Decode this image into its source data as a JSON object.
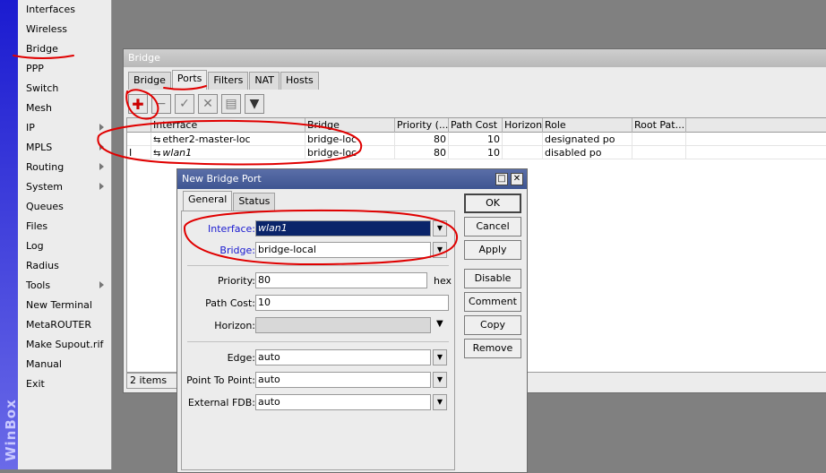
{
  "app": {
    "brand": "WinBox"
  },
  "menu": {
    "items": [
      {
        "label": "Interfaces",
        "submenu": false
      },
      {
        "label": "Wireless",
        "submenu": false
      },
      {
        "label": "Bridge",
        "submenu": false
      },
      {
        "label": "PPP",
        "submenu": false
      },
      {
        "label": "Switch",
        "submenu": false
      },
      {
        "label": "Mesh",
        "submenu": false
      },
      {
        "label": "IP",
        "submenu": true
      },
      {
        "label": "MPLS",
        "submenu": true
      },
      {
        "label": "Routing",
        "submenu": true
      },
      {
        "label": "System",
        "submenu": true
      },
      {
        "label": "Queues",
        "submenu": false
      },
      {
        "label": "Files",
        "submenu": false
      },
      {
        "label": "Log",
        "submenu": false
      },
      {
        "label": "Radius",
        "submenu": false
      },
      {
        "label": "Tools",
        "submenu": true
      },
      {
        "label": "New Terminal",
        "submenu": false
      },
      {
        "label": "MetaROUTER",
        "submenu": false
      },
      {
        "label": "Make Supout.rif",
        "submenu": false
      },
      {
        "label": "Manual",
        "submenu": false
      },
      {
        "label": "Exit",
        "submenu": false
      }
    ]
  },
  "bridge_window": {
    "title": "Bridge",
    "tabs": [
      "Bridge",
      "Ports",
      "Filters",
      "NAT",
      "Hosts"
    ],
    "active_tab": "Ports",
    "toolbar_icons": [
      "add-icon",
      "remove-icon",
      "enable-icon",
      "disable-icon",
      "comment-icon",
      "filter-icon"
    ],
    "columns": [
      "",
      "Interface",
      "Bridge",
      "Priority (...",
      "Path Cost",
      "Horizon",
      "Role",
      "Root Pat..."
    ],
    "rows": [
      {
        "flag": "",
        "interface": "ether2-master-loc",
        "bridge": "bridge-loc",
        "priority": "80",
        "path_cost": "10",
        "horizon": "",
        "role": "designated po",
        "root_path": ""
      },
      {
        "flag": "I",
        "interface": "wlan1",
        "bridge": "bridge-loc",
        "priority": "80",
        "path_cost": "10",
        "horizon": "",
        "role": "disabled po",
        "root_path": ""
      }
    ],
    "status": "2 items"
  },
  "dialog": {
    "title": "New Bridge Port",
    "tabs": [
      "General",
      "Status"
    ],
    "active_tab": "General",
    "fields": {
      "interface": {
        "label": "Interface:",
        "value": "wlan1"
      },
      "bridge": {
        "label": "Bridge:",
        "value": "bridge-local"
      },
      "priority": {
        "label": "Priority:",
        "value": "80",
        "unit": "hex"
      },
      "path_cost": {
        "label": "Path Cost:",
        "value": "10"
      },
      "horizon": {
        "label": "Horizon:",
        "value": ""
      },
      "edge": {
        "label": "Edge:",
        "value": "auto"
      },
      "point_to_point": {
        "label": "Point To Point:",
        "value": "auto"
      },
      "external_fdb": {
        "label": "External FDB:",
        "value": "auto"
      }
    },
    "buttons": {
      "ok": "OK",
      "cancel": "Cancel",
      "apply": "Apply",
      "disable": "Disable",
      "comment": "Comment",
      "copy": "Copy",
      "remove": "Remove"
    }
  },
  "colors": {
    "annotation": "#e00000",
    "sidebar_blue": "#1b1bd0",
    "dialog_title": "#3e5592"
  }
}
